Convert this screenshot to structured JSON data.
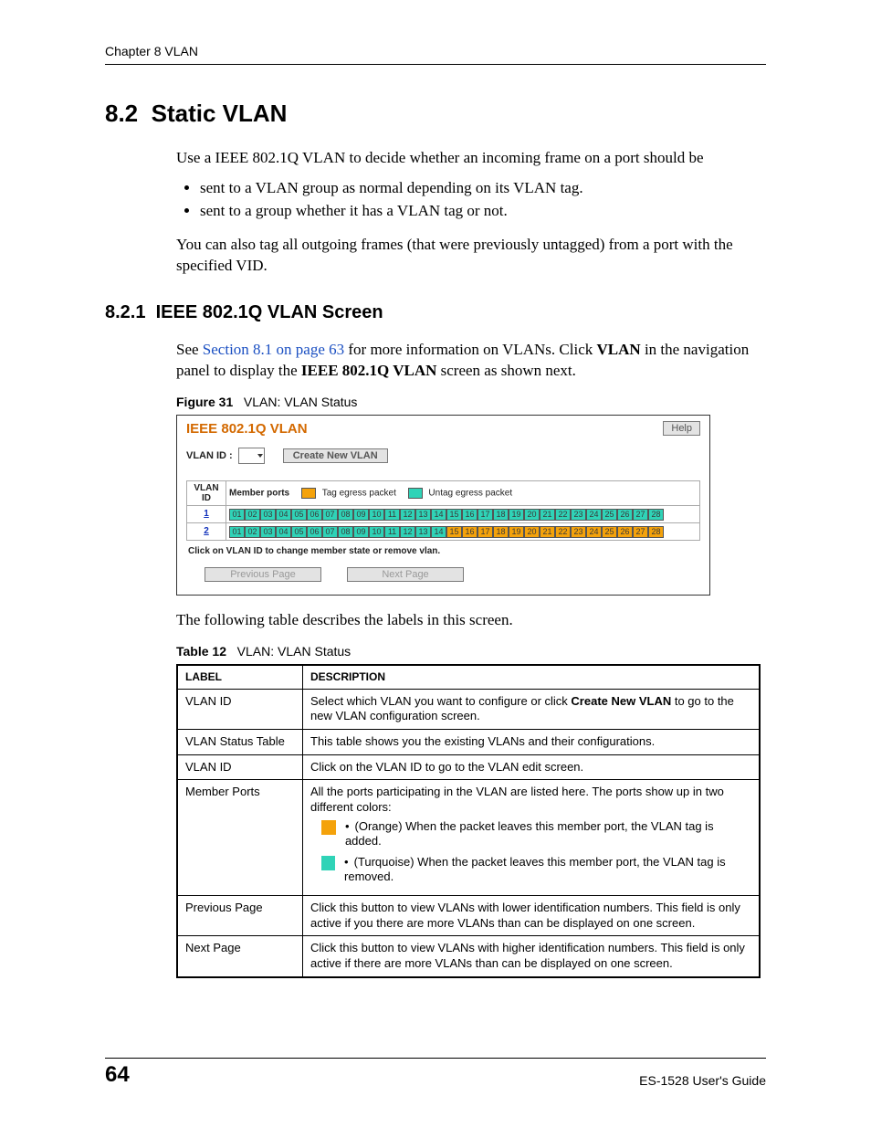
{
  "header": {
    "chapter": "Chapter 8 VLAN"
  },
  "section": {
    "number": "8.2",
    "title": "Static VLAN",
    "intro": "Use a IEEE 802.1Q VLAN to decide whether an incoming frame on a port should be",
    "bullets": [
      "sent to a VLAN group as normal depending on its VLAN tag.",
      "sent to a group whether it has a VLAN tag or not."
    ],
    "intro_tail": "You can also tag all outgoing frames (that were previously untagged) from a port with the specified VID."
  },
  "subsection": {
    "number": "8.2.1",
    "title": "IEEE 802.1Q VLAN Screen",
    "p1_pre": "See ",
    "p1_xref": "Section 8.1 on page 63",
    "p1_mid": " for more information on VLANs. Click ",
    "p1_bold1": "VLAN",
    "p1_mid2": " in the navigation panel to display the ",
    "p1_bold2": "IEEE 802.1Q VLAN",
    "p1_tail": " screen as shown next."
  },
  "figure": {
    "label_prefix": "Figure 31",
    "label_text": "VLAN: VLAN Status",
    "title": "IEEE 802.1Q VLAN",
    "help": "Help",
    "vlan_id_label": "VLAN ID :",
    "create_btn": "Create New VLAN",
    "th_vlanid": "VLAN ID",
    "th_member": "Member ports",
    "legend_tag": "Tag egress packet",
    "legend_untag": "Untag egress packet",
    "hint": "Click on VLAN ID to change member state or remove vlan.",
    "prev": "Previous Page",
    "next": "Next Page",
    "rows": [
      {
        "id": "1",
        "config": "aaaaaaaaaaaaaaaaaaaaaaaaaaaa"
      },
      {
        "id": "2",
        "config": "aaaaaaaaaaaaaabbbbbbbbbbbbbb"
      }
    ],
    "port_count": 28
  },
  "after_figure": "The following table describes the labels in this screen.",
  "table": {
    "label_prefix": "Table 12",
    "label_text": "VLAN: VLAN Status",
    "h_label": "LABEL",
    "h_desc": "DESCRIPTION",
    "rows": [
      {
        "label": "VLAN ID",
        "desc_pre": "Select which VLAN you want to configure or click ",
        "desc_bold": "Create New VLAN",
        "desc_post": " to go to the new VLAN configuration screen."
      },
      {
        "label": "VLAN Status Table",
        "desc": "This table shows you the existing VLANs and their configurations."
      },
      {
        "label": "VLAN ID",
        "desc": "Click on the VLAN ID to go to the VLAN edit screen."
      },
      {
        "label": "Member Ports",
        "desc_intro": "All the ports participating in the VLAN are listed here. The ports show up in two different colors:",
        "bullet_orange": "(Orange) When the packet leaves this member port, the VLAN tag is added.",
        "bullet_turq": "(Turquoise) When the packet leaves this member port, the VLAN tag is removed."
      },
      {
        "label": "Previous Page",
        "desc": "Click this button to view VLANs with lower identification numbers. This field is only active if you there are more VLANs than can be displayed on one screen."
      },
      {
        "label": "Next Page",
        "desc": "Click this button to view VLANs with higher identification numbers. This field is only active if there are more VLANs than can be displayed on one screen."
      }
    ]
  },
  "footer": {
    "page": "64",
    "guide": "ES-1528 User's Guide"
  }
}
